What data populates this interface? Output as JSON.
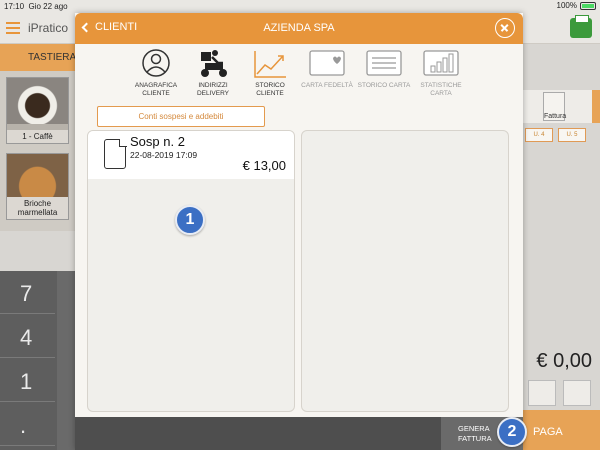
{
  "status_bar": {
    "time": "17:10",
    "date": "Gio 22 ago",
    "battery": "100%"
  },
  "app": {
    "brand": "iPratico"
  },
  "background": {
    "left_tab": "TASTIERA",
    "products": [
      {
        "label": "1 - Caffè"
      },
      {
        "label": "Brioche marmellata"
      }
    ],
    "keys": [
      "7",
      "4",
      "1",
      "."
    ],
    "right_tabs": [
      "Fattura"
    ],
    "u_tabs": [
      "U. 4",
      "U. 5"
    ],
    "total": "€ 0,00",
    "pay_label": "PAGA"
  },
  "modal": {
    "back_label": "CLIENTI",
    "title": "AZIENDA SPA",
    "nav": [
      {
        "label": "ANAGRAFICA CLIENTE",
        "state": "normal",
        "icon": "person-icon"
      },
      {
        "label": "INDIRIZZI DELIVERY",
        "state": "normal",
        "icon": "delivery-scooter-icon"
      },
      {
        "label": "STORICO CLIENTE",
        "state": "active",
        "icon": "trend-chart-icon"
      },
      {
        "label": "CARTA FEDELTÀ",
        "state": "disabled",
        "icon": "loyalty-card-icon"
      },
      {
        "label": "STORICO CARTA",
        "state": "disabled",
        "icon": "card-history-icon"
      },
      {
        "label": "STATISTICHE CARTA",
        "state": "disabled",
        "icon": "bar-stats-icon"
      }
    ],
    "subtab_label": "Conti sospesi e addebiti",
    "records": [
      {
        "title": "Sosp n. 2",
        "date": "22-08-2019 17:09",
        "amount": "€ 13,00"
      }
    ],
    "footer": {
      "genera_fattura_label": "GENERA FATTURA"
    }
  },
  "annotations": {
    "badge_1": "1",
    "badge_2": "2"
  },
  "colors": {
    "accent": "#e7953b",
    "badge": "#3b6fc4",
    "footer": "#4e4e4e"
  }
}
